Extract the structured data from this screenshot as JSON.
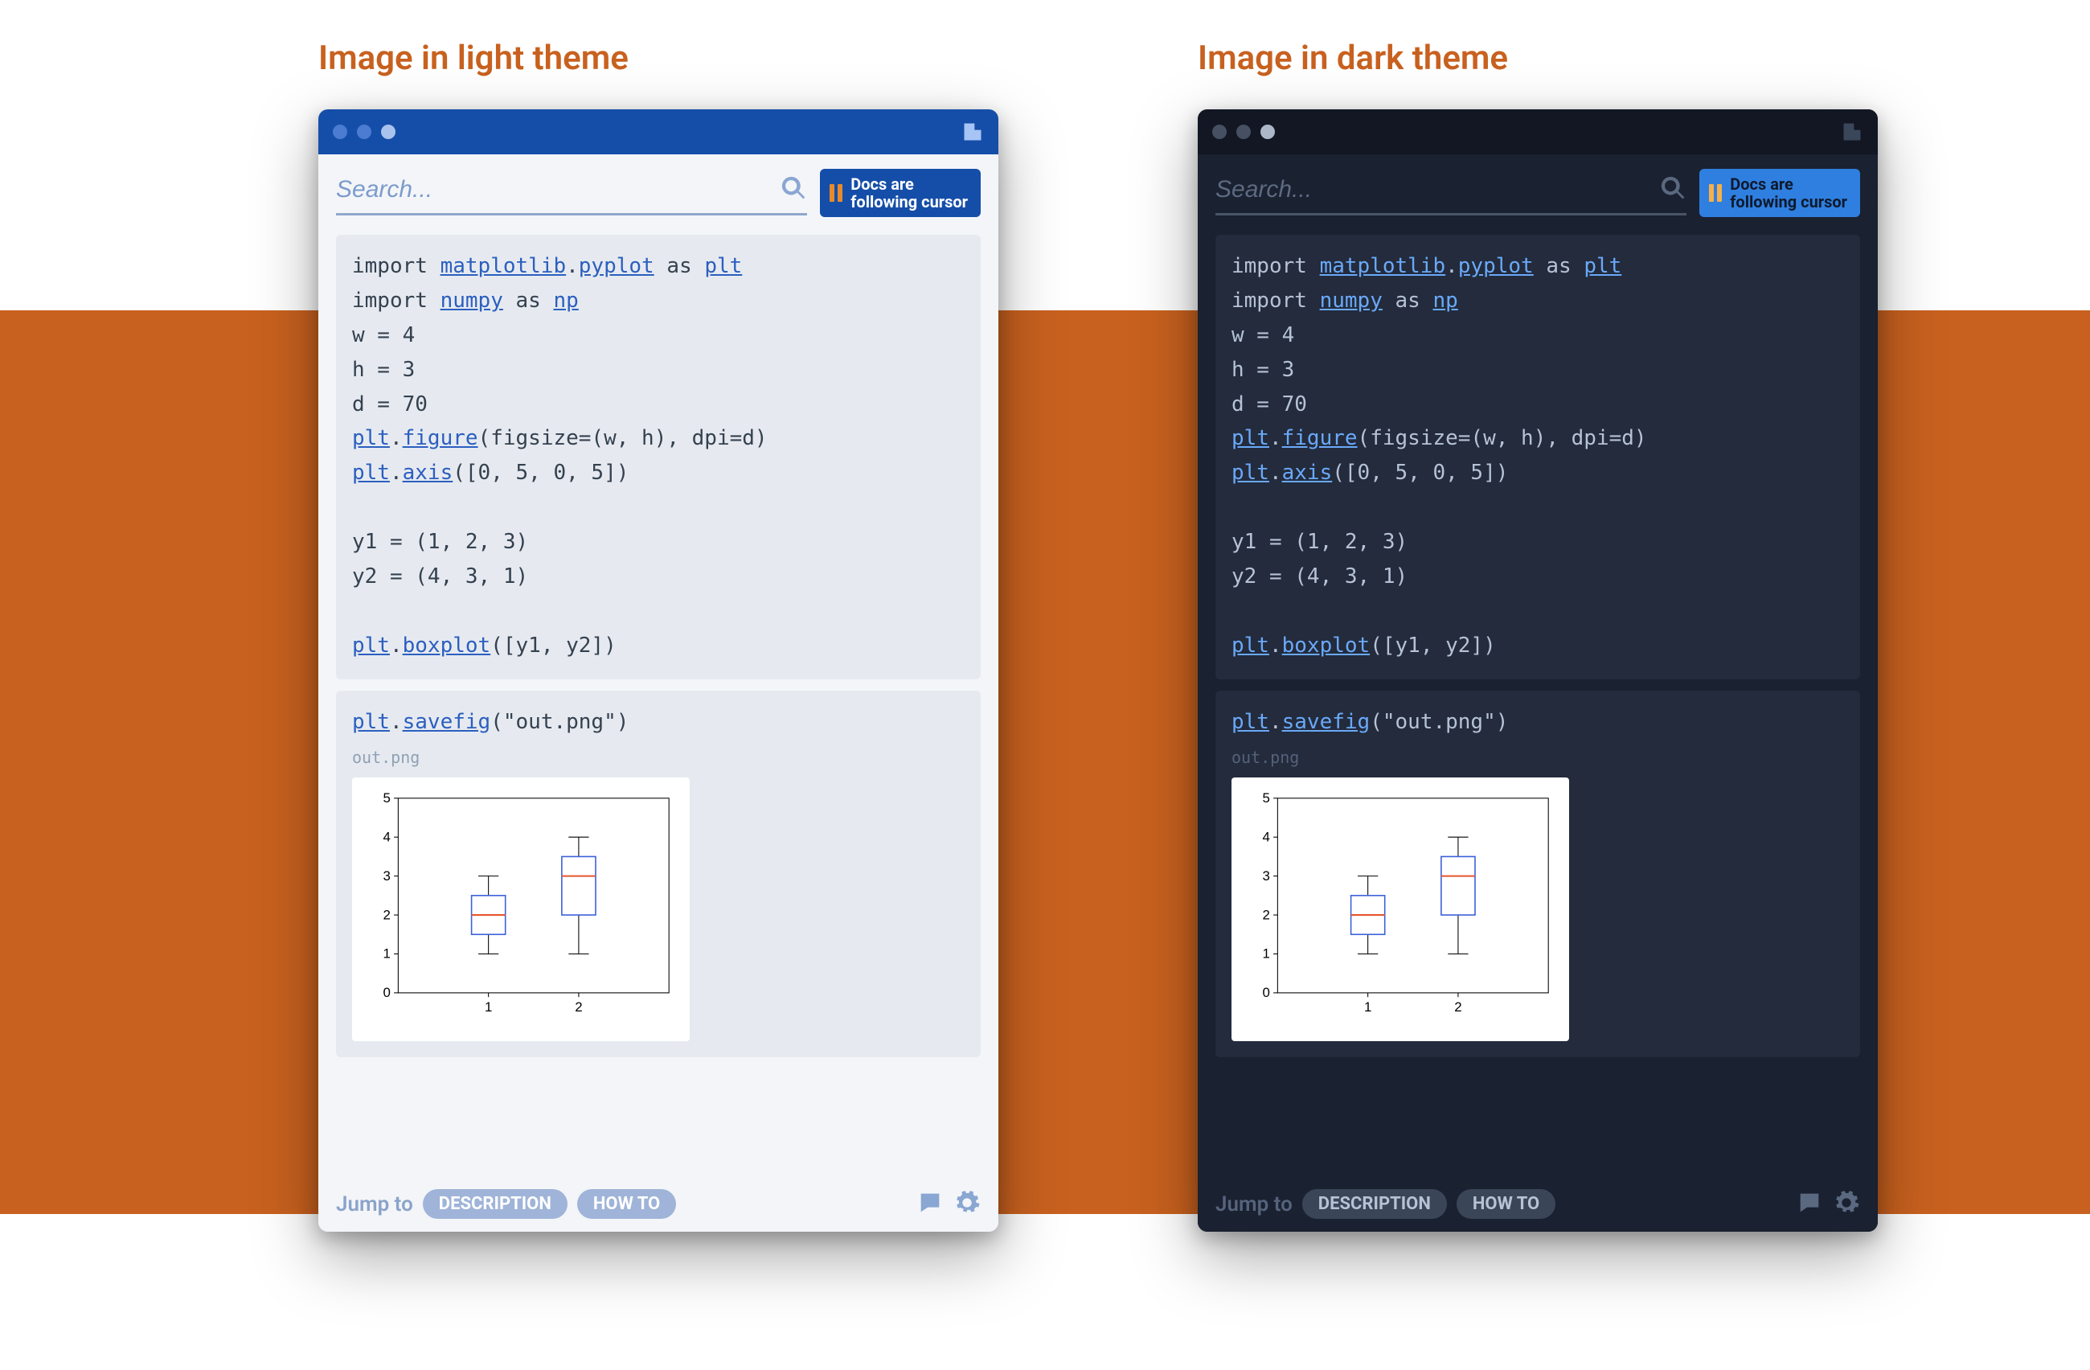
{
  "labels": {
    "light_theme": "Image in light theme",
    "dark_theme": "Image in dark theme"
  },
  "search": {
    "placeholder": "Search..."
  },
  "follow_button": {
    "line1": "Docs are",
    "line2": "following cursor"
  },
  "code": {
    "block1": {
      "l1_pre": "import ",
      "l1_link1": "matplotlib",
      "l1_dot": ".",
      "l1_link2": "pyplot",
      "l1_mid": " as ",
      "l1_link3": "plt",
      "l2_pre": "import ",
      "l2_link1": "numpy",
      "l2_mid": " as ",
      "l2_link2": "np",
      "l3": "w = 4",
      "l4": "h = 3",
      "l5": "d = 70",
      "l6_link1": "plt",
      "l6_dot": ".",
      "l6_link2": "figure",
      "l6_args": "(figsize=(w, h), dpi=d)",
      "l7_link1": "plt",
      "l7_dot": ".",
      "l7_link2": "axis",
      "l7_args": "([0, 5, 0, 5])",
      "l8": "",
      "l9": "y1 = (1, 2, 3)",
      "l10": "y2 = (4, 3, 1)",
      "l11": "",
      "l12_link1": "plt",
      "l12_dot": ".",
      "l12_link2": "boxplot",
      "l12_args": "([y1, y2])"
    },
    "block2": {
      "l1_link1": "plt",
      "l1_dot": ".",
      "l1_link2": "savefig",
      "l1_args": "(\"out.png\")"
    },
    "output_filename": "out.png"
  },
  "footer": {
    "jump_label": "Jump to",
    "pill1": "DESCRIPTION",
    "pill2": "HOW TO"
  },
  "chart_data": {
    "type": "boxplot",
    "title": "",
    "xlabel": "",
    "ylabel": "",
    "xlim": [
      0.5,
      2.5
    ],
    "ylim": [
      0,
      5
    ],
    "xticks": [
      1,
      2
    ],
    "yticks": [
      0,
      1,
      2,
      3,
      4,
      5
    ],
    "series": [
      {
        "name": "1",
        "values": [
          1,
          2,
          3
        ],
        "min": 1,
        "q1": 1.5,
        "median": 2,
        "q3": 2.5,
        "max": 3
      },
      {
        "name": "2",
        "values": [
          4,
          3,
          1
        ],
        "min": 1,
        "q1": 2.0,
        "median": 3,
        "q3": 3.5,
        "max": 4
      }
    ]
  }
}
